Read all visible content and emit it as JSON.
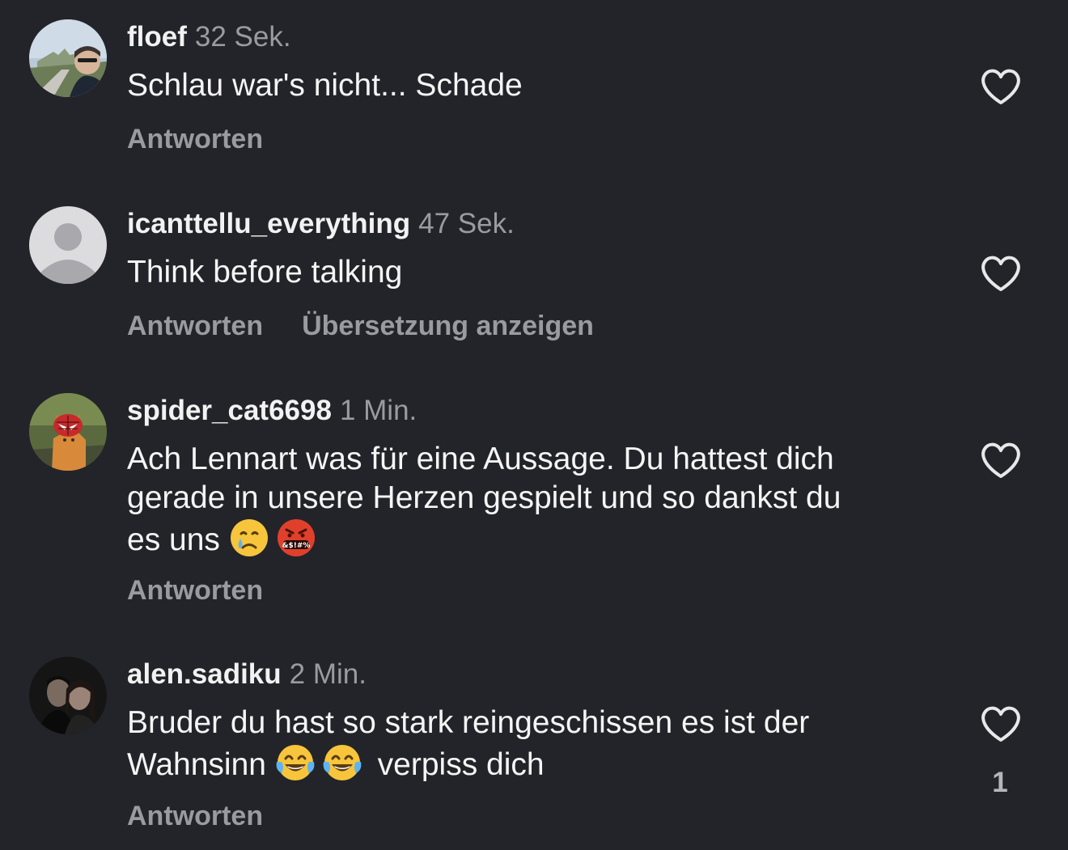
{
  "comments": [
    {
      "username": "floef",
      "time": "32 Sek.",
      "text": "Schlau war's nicht... Schade",
      "reply_label": "Antworten",
      "translate_label": "",
      "like_count": ""
    },
    {
      "username": "icanttellu_everything",
      "time": "47 Sek.",
      "text": "Think before talking",
      "reply_label": "Antworten",
      "translate_label": "Übersetzung anzeigen",
      "like_count": ""
    },
    {
      "username": "spider_cat6698",
      "time": "1 Min.",
      "text_line1": "Ach Lennart was für eine Aussage. Du hattest dich",
      "text_line2": "gerade in unsere Herzen gespielt und so dankst du",
      "text_line3": "es uns",
      "emojis": [
        "crying-face-emoji",
        "cursing-face-emoji"
      ],
      "reply_label": "Antworten",
      "like_count": ""
    },
    {
      "username": "alen.sadiku",
      "time": "2 Min.",
      "text_line1": "Bruder du hast so stark reingeschissen es ist der",
      "text_line2_start": "Wahnsinn",
      "text_line2_end": "verpiss dich",
      "emojis": [
        "tears-of-joy-emoji",
        "tears-of-joy-emoji"
      ],
      "reply_label": "Antworten",
      "like_count": "1"
    }
  ],
  "colors": {
    "background": "#232429",
    "username": "#f2f2f2",
    "secondary_text": "#9a9ba1",
    "body_text": "#f5f5f5",
    "heart_outline": "#e8e8ea"
  }
}
